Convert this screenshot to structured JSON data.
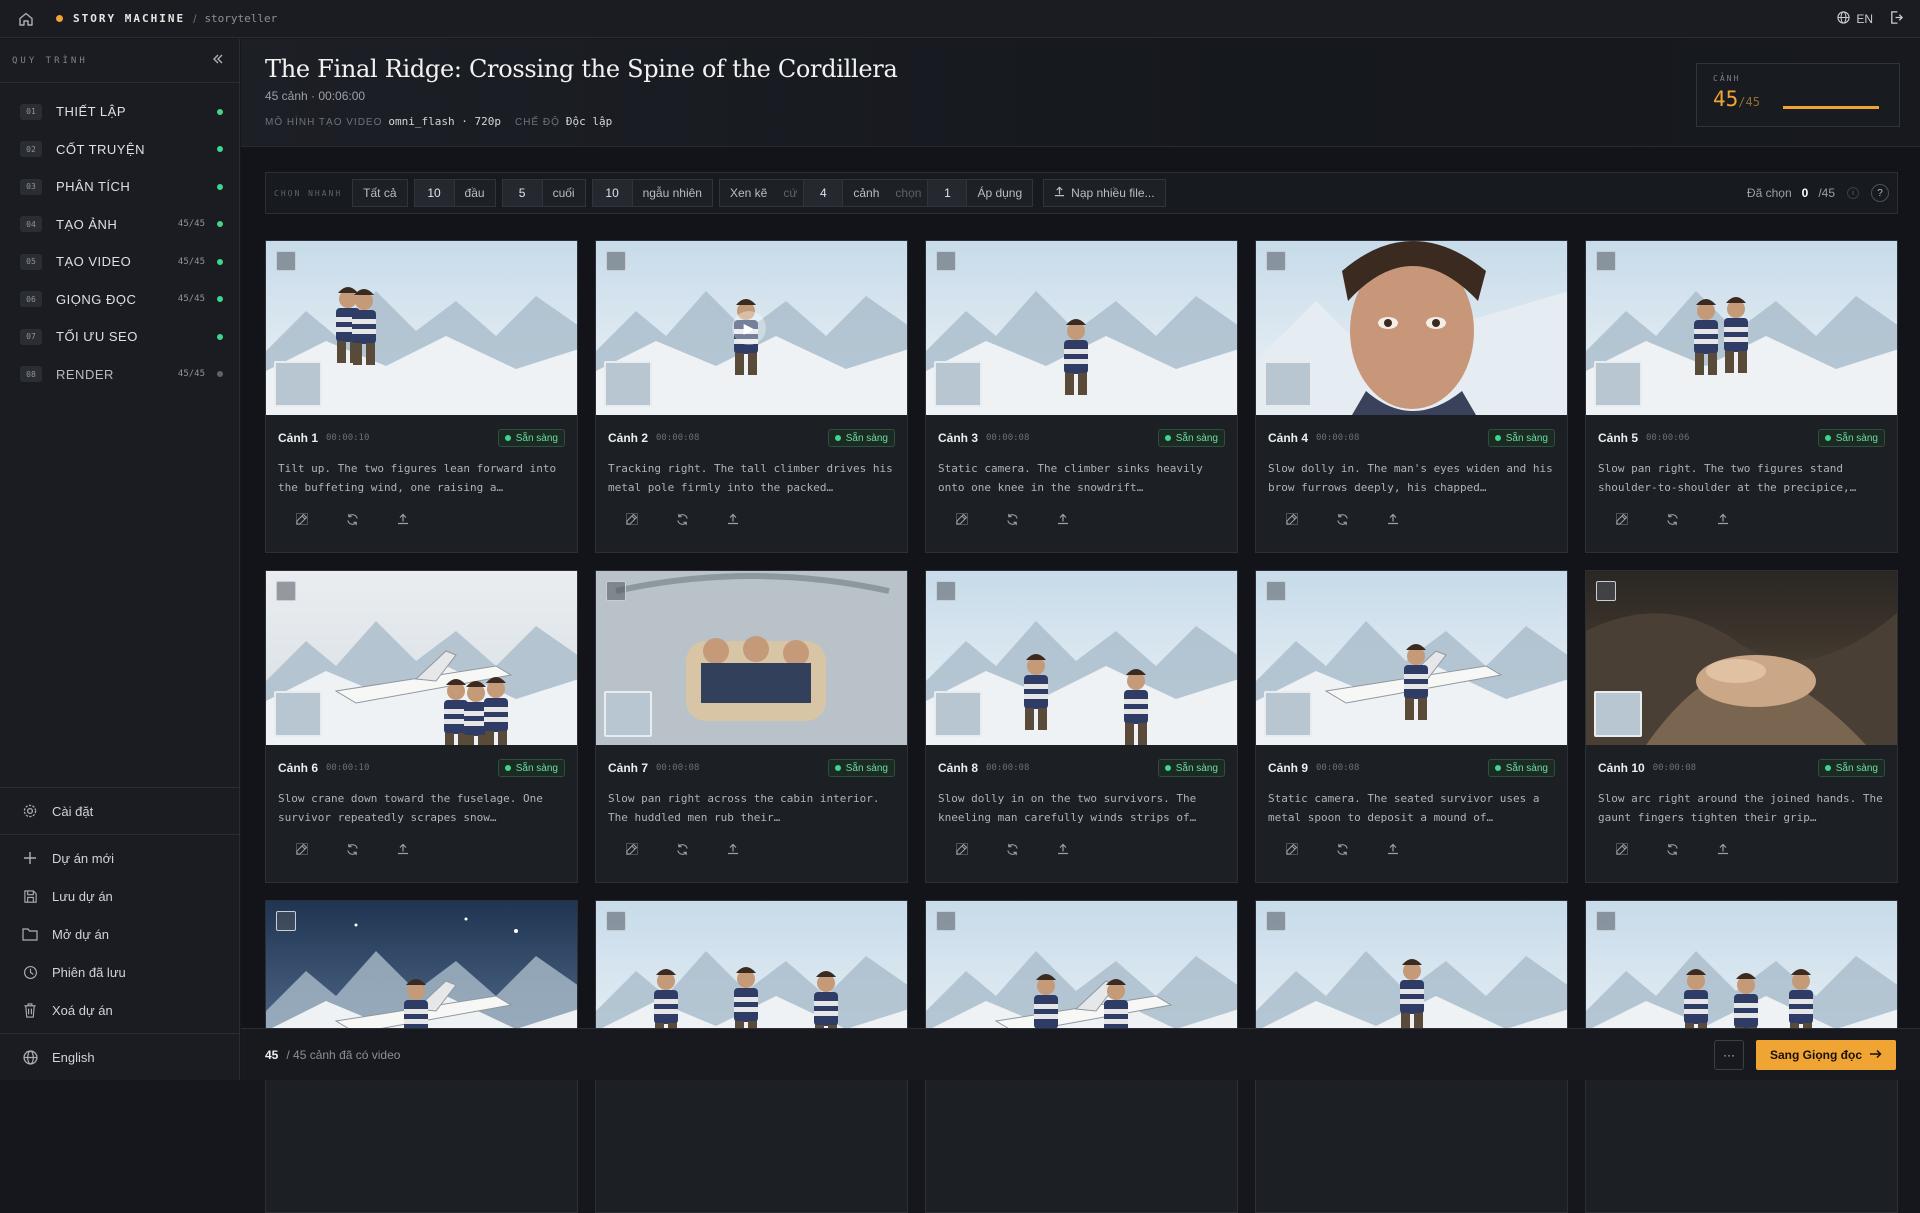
{
  "topbar": {
    "brand": "STORY MACHINE",
    "crumb_sep": "/",
    "crumb": "storyteller",
    "lang": "EN"
  },
  "sidebar": {
    "title": "QUY TRÌNH",
    "steps": [
      {
        "num": "01",
        "label": "THIẾT LẬP",
        "count": "",
        "state": "done"
      },
      {
        "num": "02",
        "label": "CỐT TRUYỆN",
        "count": "",
        "state": "done"
      },
      {
        "num": "03",
        "label": "PHÂN TÍCH",
        "count": "",
        "state": "done"
      },
      {
        "num": "04",
        "label": "TẠO ẢNH",
        "count": "45/45",
        "state": "done"
      },
      {
        "num": "05",
        "label": "TẠO VIDEO",
        "count": "45/45",
        "state": "done"
      },
      {
        "num": "06",
        "label": "GIỌNG ĐỌC",
        "count": "45/45",
        "state": "done"
      },
      {
        "num": "07",
        "label": "TỐI ƯU SEO",
        "count": "",
        "state": "done"
      },
      {
        "num": "08",
        "label": "RENDER",
        "count": "45/45",
        "state": "pending"
      }
    ],
    "settings": "Cài đặt",
    "actions": [
      "Dự án mới",
      "Lưu dự án",
      "Mở dự án",
      "Phiên đã lưu",
      "Xoá dự án"
    ],
    "language": "English"
  },
  "header": {
    "title": "The Final Ridge: Crossing the Spine of the Cordillera",
    "subtitle": "45 cảnh · 00:06:00",
    "model_label": "MÔ HÌNH TẠO VIDEO",
    "model_value": "omni_flash · 720p",
    "mode_label": "CHẾ ĐỘ",
    "mode_value": "Độc lập",
    "scene_label": "CẢNH",
    "scene_done": "45",
    "scene_total": "/45",
    "scene_progress": 1.0
  },
  "toolbar": {
    "quick_label": "CHỌN NHANH",
    "all": "Tất cả",
    "first_n": "10",
    "first_label": "đầu",
    "last_n": "5",
    "last_label": "cuối",
    "random_n": "10",
    "random_label": "ngẫu nhiên",
    "alt_label": "Xen kẽ",
    "every_label": "cứ",
    "every_n": "4",
    "scene_word": "cảnh",
    "pick_label": "chọn",
    "pick_n": "1",
    "apply": "Áp dụng",
    "upload": "Nạp nhiều file...",
    "selected_label": "Đã chọn",
    "selected_n": "0",
    "selected_total": "/45"
  },
  "cards": [
    {
      "title": "Cảnh 1",
      "time": "00:00:10",
      "status": "Sẵn sàng",
      "desc": "Tilt up. The two figures lean forward into the buffeting wind, one raising a…",
      "scene": "peak"
    },
    {
      "title": "Cảnh 2",
      "time": "00:00:08",
      "status": "Sẵn sàng",
      "desc": "Tracking right. The tall climber drives his metal pole firmly into the packed…",
      "scene": "climber"
    },
    {
      "title": "Cảnh 3",
      "time": "00:00:08",
      "status": "Sẵn sàng",
      "desc": "Static camera. The climber sinks heavily onto one knee in the snowdrift…",
      "scene": "kneel"
    },
    {
      "title": "Cảnh 4",
      "time": "00:00:08",
      "status": "Sẵn sàng",
      "desc": "Slow dolly in. The man's eyes widen and his brow furrows deeply, his chapped…",
      "scene": "face"
    },
    {
      "title": "Cảnh 5",
      "time": "00:00:06",
      "status": "Sẵn sàng",
      "desc": "Slow pan right. The two figures stand shoulder-to-shoulder at the precipice,…",
      "scene": "pair"
    },
    {
      "title": "Cảnh 6",
      "time": "00:00:10",
      "status": "Sẵn sàng",
      "desc": "Slow crane down toward the fuselage. One survivor repeatedly scrapes snow…",
      "scene": "plane"
    },
    {
      "title": "Cảnh 7",
      "time": "00:00:08",
      "status": "Sẵn sàng",
      "desc": "Slow pan right across the cabin interior. The huddled men rub their…",
      "scene": "cabin"
    },
    {
      "title": "Cảnh 8",
      "time": "00:00:08",
      "status": "Sẵn sàng",
      "desc": "Slow dolly in on the two survivors. The kneeling man carefully winds strips of…",
      "scene": "care"
    },
    {
      "title": "Cảnh 9",
      "time": "00:00:08",
      "status": "Sẵn sàng",
      "desc": "Static camera. The seated survivor uses a metal spoon to deposit a mound of…",
      "scene": "seated"
    },
    {
      "title": "Cảnh 10",
      "time": "00:00:08",
      "status": "Sẵn sàng",
      "desc": "Slow arc right around the joined hands. The gaunt fingers tighten their grip…",
      "scene": "hands"
    },
    {
      "title": "",
      "time": "",
      "status": "",
      "desc": "",
      "scene": "night"
    },
    {
      "title": "",
      "time": "",
      "status": "",
      "desc": "",
      "scene": "group"
    },
    {
      "title": "",
      "time": "",
      "status": "",
      "desc": "",
      "scene": "door"
    },
    {
      "title": "",
      "time": "",
      "status": "",
      "desc": "",
      "scene": "rope"
    },
    {
      "title": "",
      "time": "",
      "status": "",
      "desc": "",
      "scene": "trek"
    }
  ],
  "footer": {
    "count": "45",
    "text": "/ 45 cảnh đã có video",
    "more": "···",
    "next": "Sang Giọng đọc"
  },
  "colors": {
    "accent": "#f0a434",
    "ready": "#3dd68c"
  }
}
